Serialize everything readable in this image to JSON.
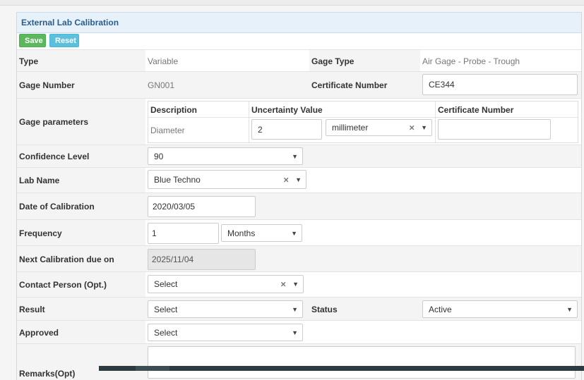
{
  "panel": {
    "title": "External Lab Calibration",
    "save_label": "Save",
    "reset_label": "Reset"
  },
  "type": {
    "label": "Type",
    "value": "Variable"
  },
  "gage_type": {
    "label": "Gage Type",
    "value": "Air Gage - Probe - Trough"
  },
  "gage_number": {
    "label": "Gage Number",
    "value": "GN001"
  },
  "certificate_number": {
    "label": "Certificate Number",
    "value": "CE344"
  },
  "gage_parameters": {
    "label": "Gage parameters",
    "headers": {
      "description": "Description",
      "uncertainty": "Uncertainty Value",
      "certificate": "Certificate Number"
    },
    "row": {
      "description": "Diameter",
      "uncertainty_value": "2",
      "unit": "millimeter",
      "certificate_value": ""
    }
  },
  "confidence_level": {
    "label": "Confidence Level",
    "value": "90"
  },
  "lab_name": {
    "label": "Lab Name",
    "value": "Blue Techno"
  },
  "date_of_calibration": {
    "label": "Date of Calibration",
    "value": "2020/03/05"
  },
  "frequency": {
    "label": "Frequency",
    "value": "1",
    "unit": "Months"
  },
  "next_calibration": {
    "label": "Next Calibration due on",
    "value": "2025/11/04"
  },
  "contact_person": {
    "label": "Contact Person (Opt.)",
    "value": "Select"
  },
  "result": {
    "label": "Result",
    "value": "Select"
  },
  "status": {
    "label": "Status",
    "value": "Active"
  },
  "approved": {
    "label": "Approved",
    "value": "Select"
  },
  "remarks": {
    "label": "Remarks(Opt)",
    "value": ""
  },
  "icons": {
    "caret": "▼",
    "clear": "×"
  }
}
